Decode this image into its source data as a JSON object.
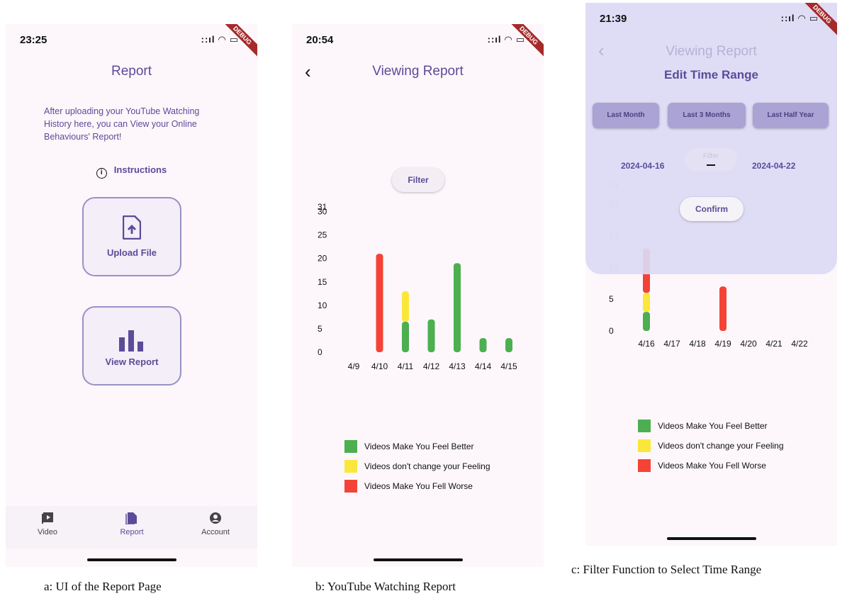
{
  "screen_a": {
    "time": "23:25",
    "title": "Report",
    "intro": "After uploading your YouTube Watching History here, you can View your Online Behaviours' Report!",
    "instructions": "Instructions",
    "upload_label": "Upload File",
    "view_label": "View Report",
    "tabs": [
      {
        "label": "Video",
        "icon": "video-library-icon"
      },
      {
        "label": "Report",
        "icon": "document-icon"
      },
      {
        "label": "Account",
        "icon": "account-circle-icon"
      }
    ],
    "debug": "DEBUG"
  },
  "screen_b": {
    "time": "20:54",
    "title": "Viewing Report",
    "filter_label": "Filter",
    "debug": "DEBUG"
  },
  "screen_c": {
    "time": "21:39",
    "title": "Viewing Report",
    "overlay_title": "Edit Time Range",
    "range_buttons": [
      "Last Month",
      "Last 3 Months",
      "Last Half Year"
    ],
    "start_date": "2024-04-16",
    "end_date": "2024-04-22",
    "filter_ghost": "Filter",
    "confirm_label": "Confirm",
    "debug": "DEBUG"
  },
  "legend": [
    "Videos Make You Feel Better",
    "Videos don't change your Feeling",
    "Videos Make You Fell Worse"
  ],
  "colors": {
    "better": "#4caf50",
    "neutral": "#fbe73b",
    "worse": "#f44336",
    "accent": "#5b4b99"
  },
  "chart_data": [
    {
      "type": "bar",
      "stacked": true,
      "categories": [
        "4/9",
        "4/10",
        "4/11",
        "4/12",
        "4/13",
        "4/14",
        "4/15"
      ],
      "yticks": [
        0,
        5,
        10,
        15,
        20,
        25,
        30,
        31
      ],
      "ylim": [
        0,
        31
      ],
      "series": [
        {
          "name": "Videos Make You Feel Better",
          "values": [
            0,
            0,
            6.5,
            7,
            19,
            3,
            3
          ]
        },
        {
          "name": "Videos don't change your Feeling",
          "values": [
            0,
            0,
            6.5,
            0,
            0,
            0,
            0
          ]
        },
        {
          "name": "Videos Make You Fell Worse",
          "values": [
            0,
            21,
            0,
            0,
            0,
            0,
            0
          ]
        }
      ]
    },
    {
      "type": "bar",
      "stacked": true,
      "categories": [
        "4/16",
        "4/17",
        "4/18",
        "4/19",
        "4/20",
        "4/21",
        "4/22"
      ],
      "yticks": [
        0,
        5,
        10,
        15,
        20,
        23
      ],
      "ylim": [
        0,
        23
      ],
      "series": [
        {
          "name": "Videos Make You Feel Better",
          "values": [
            3,
            0,
            0,
            0,
            0,
            0,
            0
          ]
        },
        {
          "name": "Videos don't change your Feeling",
          "values": [
            3,
            0,
            0,
            0,
            0,
            0,
            0
          ]
        },
        {
          "name": "Videos Make You Fell Worse",
          "values": [
            7,
            0,
            0,
            7,
            0,
            0,
            0
          ]
        }
      ]
    }
  ],
  "captions": {
    "a": "a: UI of the Report Page",
    "b": "b: YouTube Watching Report",
    "c": "c: Filter Function to Select Time Range"
  }
}
